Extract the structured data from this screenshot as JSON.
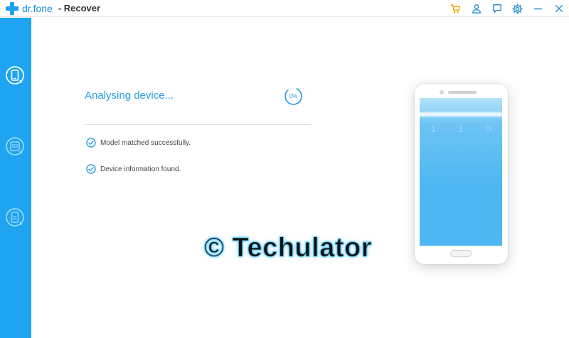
{
  "window": {
    "brand": "dr.fone",
    "title": "- Recover"
  },
  "toolbar": {
    "icons": [
      "cart-icon",
      "user-icon",
      "feedback-icon",
      "settings-icon",
      "minimize-icon",
      "close-icon"
    ]
  },
  "sidebar": {
    "items": [
      {
        "name": "recover-from-device",
        "icon": "phone-recover-icon",
        "active": true
      },
      {
        "name": "recover-from-itunes",
        "icon": "itunes-recover-icon",
        "active": false
      },
      {
        "name": "recover-from-icloud",
        "icon": "icloud-recover-icon",
        "active": false
      }
    ]
  },
  "main": {
    "status_title": "Analysing device...",
    "progress": "0%",
    "steps": [
      {
        "label": "Model matched successfully."
      },
      {
        "label": "Device information found."
      }
    ]
  },
  "phone": {
    "screen_digits": [
      "1",
      "1",
      "0"
    ]
  },
  "watermark": {
    "text": "© Techulator"
  },
  "colors": {
    "accent": "#1ea4f0",
    "status_text": "#2a9be0",
    "icon": "#2b8fd0",
    "cart": "#f2a100"
  }
}
